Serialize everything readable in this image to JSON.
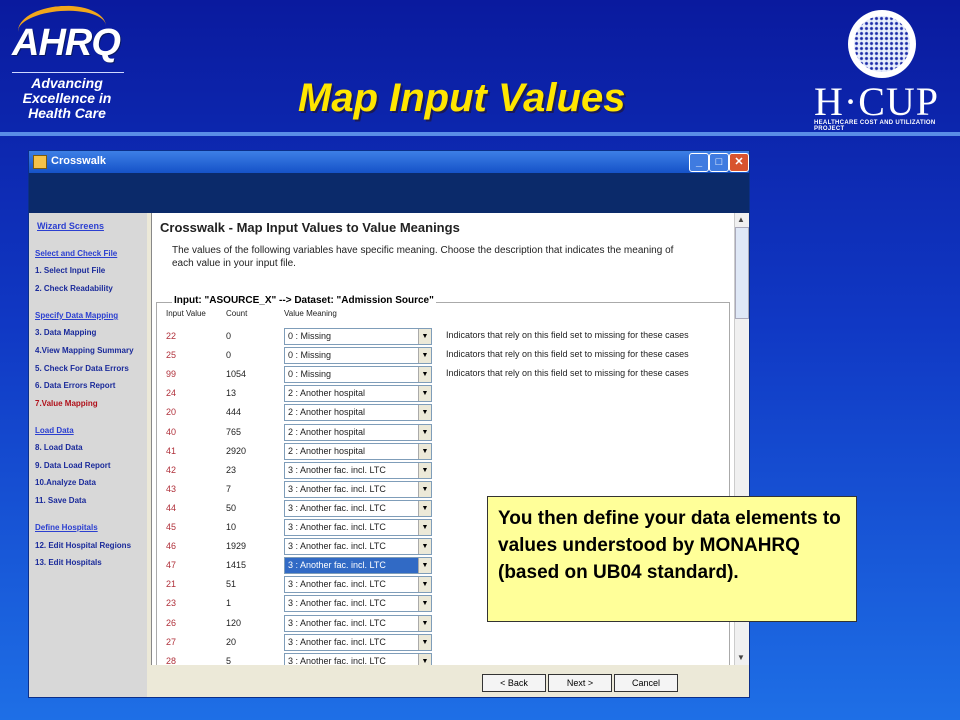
{
  "header": {
    "logo_text": "AHRQ",
    "tagline": [
      "Advancing",
      "Excellence in",
      "Health Care"
    ],
    "title": "Map Input Values",
    "hcup_logo": "H·CUP",
    "hcup_sub": "HEALTHCARE COST AND UTILIZATION PROJECT"
  },
  "window": {
    "title": "Crosswalk",
    "controls": {
      "minimize": "_",
      "maximize": "□",
      "close": "✕"
    }
  },
  "sidebar": {
    "heading": "Wizard Screens",
    "sections": [
      {
        "label": "Select and Check File",
        "items": [
          "1. Select Input File",
          "2. Check Readability"
        ]
      },
      {
        "label": "Specify Data Mapping",
        "items": [
          "3. Data Mapping",
          "4.View Mapping Summary",
          "5. Check For Data Errors",
          "6. Data Errors Report",
          "7.Value Mapping"
        ]
      },
      {
        "label": "Load Data",
        "items": [
          "8. Load Data",
          "9. Data Load Report",
          "10.Analyze Data",
          "11. Save Data"
        ]
      },
      {
        "label": "Define Hospitals",
        "items": [
          "12. Edit Hospital Regions",
          "13. Edit Hospitals"
        ]
      }
    ],
    "active_item": "7.Value Mapping"
  },
  "content": {
    "title": "Crosswalk - Map Input Values to Value Meanings",
    "description": "The values of the following variables have specific meaning.  Choose the description that indicates the meaning of each value in your input file.",
    "group_title": "Input: \"ASOURCE_X\" --> Dataset: \"Admission Source\"",
    "columns": [
      "Input Value",
      "Count",
      "Value Meaning"
    ],
    "rows": [
      {
        "input": "22",
        "count": "0",
        "meaning": "0 : Missing",
        "note": "Indicators that rely on this field set to missing for these cases"
      },
      {
        "input": "25",
        "count": "0",
        "meaning": "0 : Missing",
        "note": "Indicators that rely on this field set to missing for these cases"
      },
      {
        "input": "99",
        "count": "1054",
        "meaning": "0 : Missing",
        "note": "Indicators that rely on this field set to missing for these cases"
      },
      {
        "input": "24",
        "count": "13",
        "meaning": "2 : Another hospital",
        "note": ""
      },
      {
        "input": "20",
        "count": "444",
        "meaning": "2 : Another hospital",
        "note": ""
      },
      {
        "input": "40",
        "count": "765",
        "meaning": "2 : Another hospital",
        "note": ""
      },
      {
        "input": "41",
        "count": "2920",
        "meaning": "2 : Another hospital",
        "note": ""
      },
      {
        "input": "42",
        "count": "23",
        "meaning": "3 : Another fac. incl. LTC",
        "note": ""
      },
      {
        "input": "43",
        "count": "7",
        "meaning": "3 : Another fac. incl. LTC",
        "note": ""
      },
      {
        "input": "44",
        "count": "50",
        "meaning": "3 : Another fac. incl. LTC",
        "note": ""
      },
      {
        "input": "45",
        "count": "10",
        "meaning": "3 : Another fac. incl. LTC",
        "note": ""
      },
      {
        "input": "46",
        "count": "1929",
        "meaning": "3 : Another fac. incl. LTC",
        "note": ""
      },
      {
        "input": "47",
        "count": "1415",
        "meaning": "3 : Another fac. incl. LTC",
        "note": "",
        "selected": true
      },
      {
        "input": "21",
        "count": "51",
        "meaning": "3 : Another fac. incl. LTC",
        "note": ""
      },
      {
        "input": "23",
        "count": "1",
        "meaning": "3 : Another fac. incl. LTC",
        "note": ""
      },
      {
        "input": "26",
        "count": "120",
        "meaning": "3 : Another fac. incl. LTC",
        "note": ""
      },
      {
        "input": "27",
        "count": "20",
        "meaning": "3 : Another fac. incl. LTC",
        "note": ""
      },
      {
        "input": "28",
        "count": "5",
        "meaning": "3 : Another fac. incl. LTC",
        "note": ""
      }
    ]
  },
  "footer": {
    "back": "< Back",
    "next": "Next >",
    "cancel": "Cancel"
  },
  "callout": "You then define your data elements to values understood by MONAHRQ (based on UB04 standard)."
}
